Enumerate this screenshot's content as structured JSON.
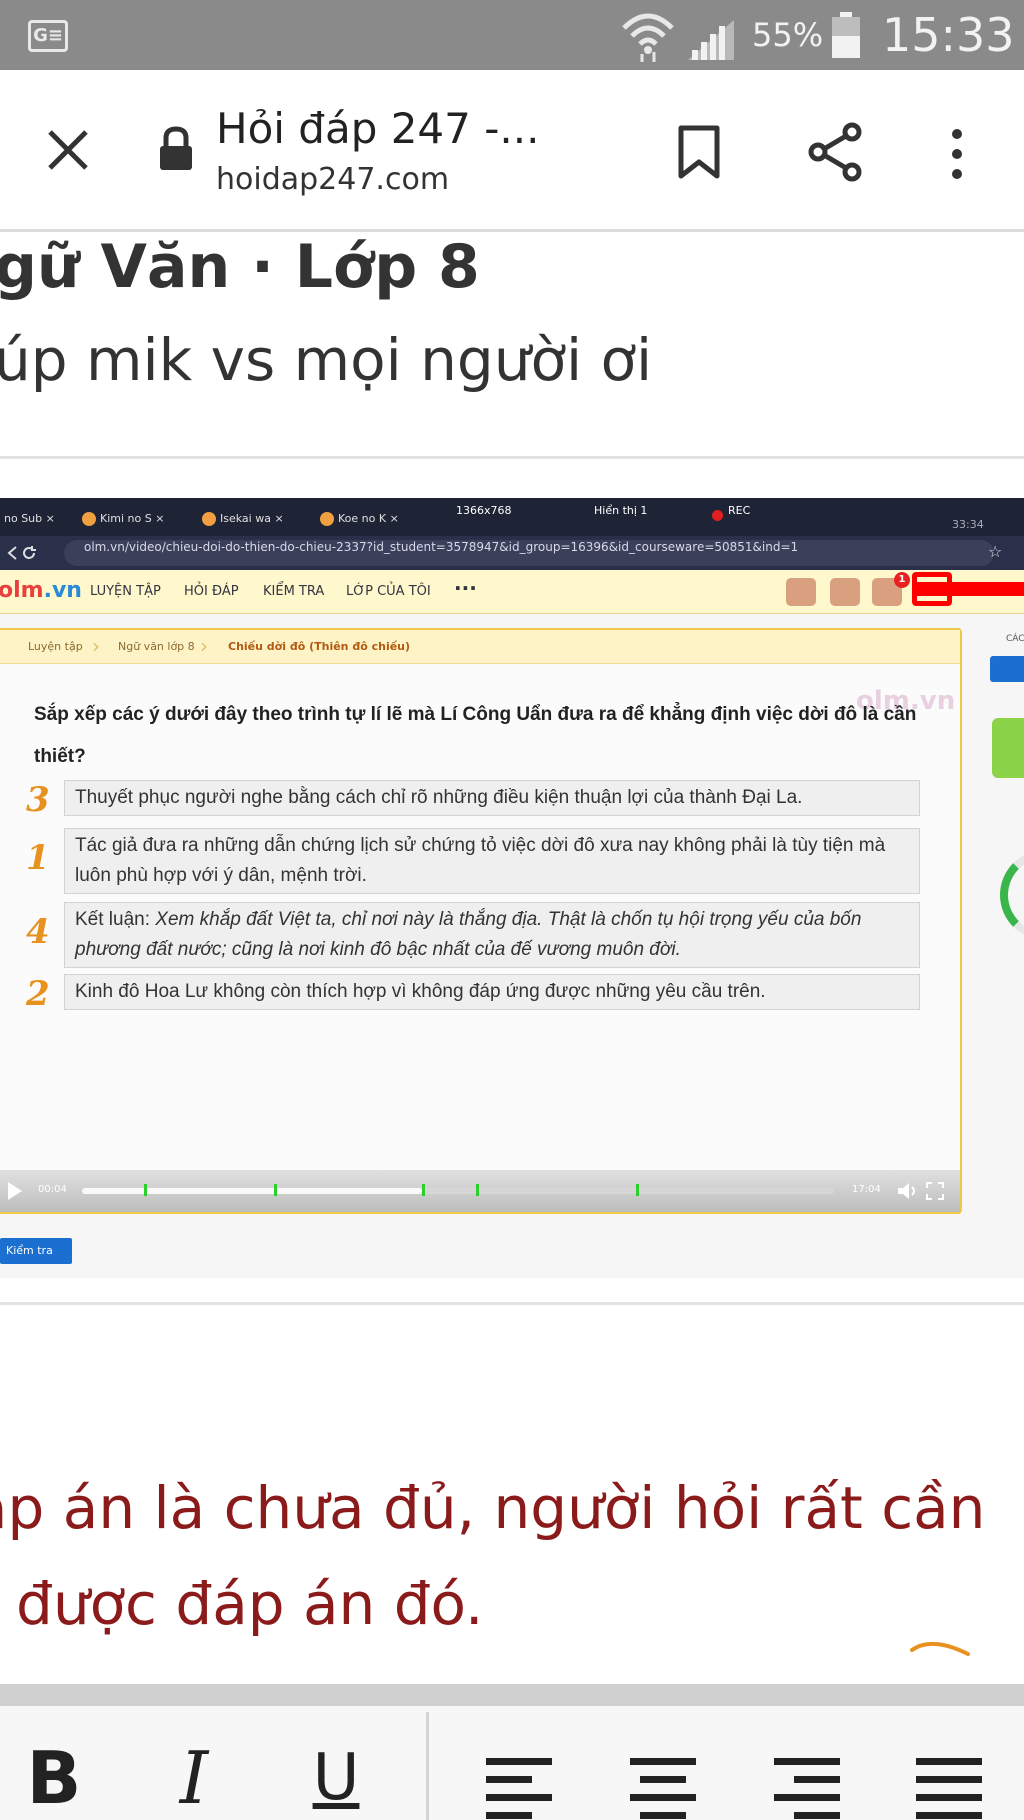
{
  "status_bar": {
    "carrier_icon_text": "G≡",
    "battery_percent": "55%",
    "time": "15:33"
  },
  "toolbar": {
    "title": "Hỏi đáp 247 -...",
    "url": "hoidap247.com"
  },
  "page": {
    "subject": "gữ Văn · Lớp 8",
    "question": "úp mik vs mọi người ơi",
    "warning_line1": "áp án là chưa đủ, người hỏi rất cần",
    "warning_line2": "được đáp án đó."
  },
  "screenshot": {
    "tabs": [
      {
        "label": "no Sub",
        "close": "×"
      },
      {
        "label": "Kimi no S",
        "close": "×"
      },
      {
        "label": "Isekai wa",
        "close": "×"
      },
      {
        "label": "Koe no K",
        "close": "×"
      }
    ],
    "resolution": "1366x768",
    "display": "Hiển thị 1",
    "rec": "REC",
    "clock": "33:34",
    "url": "olm.vn/video/chieu-doi-do-thien-do-chieu-2337?id_student=3578947&id_group=16396&id_courseware=50851&ind=1",
    "logo_main": "olm",
    "logo_ext": ".vn",
    "nav": [
      "LUYỆN TẬP",
      "HỎI ĐÁP",
      "KIỂM TRA",
      "LỚP CỦA TÔI"
    ],
    "nav_more": "···",
    "badge": "1",
    "breadcrumbs": [
      "Luyện tập",
      "Ngữ văn lớp 8",
      "Chiếu dời đô (Thiên đô chiếu)"
    ],
    "watermark": "olm.vn",
    "question": "Sắp xếp các ý dưới đây theo trình tự lí lẽ mà Lí Công Uẩn đưa ra để khẳng định việc dời đô là cần thiết?",
    "items": [
      {
        "mark": "3",
        "text": "Thuyết phục người nghe bằng cách chỉ rõ những điều kiện thuận lợi của thành Đại La."
      },
      {
        "mark": "1",
        "text": "Tác giả đưa ra những dẫn chứng lịch sử chứng tỏ việc dời đô xưa nay không phải là tùy tiện mà luôn phù hợp với ý dân, mệnh trời."
      },
      {
        "mark": "4",
        "prefix": "Kết luận: ",
        "text": "Xem khắp đất Việt ta, chỉ nơi này là thắng địa. Thật là chốn tụ hội trọng yếu của bốn phương đất nước; cũng là nơi kinh đô bậc nhất của đế vương muôn đời."
      },
      {
        "mark": "2",
        "text": "Kinh đô Hoa Lư không còn thích hợp vì không đáp ứng được những yêu cầu trên."
      }
    ],
    "time_current": "00:04",
    "time_total": "17:04",
    "check_button": "Kiểm tra",
    "side_label": "CÁC"
  },
  "editor": {
    "bold": "B",
    "italic": "I",
    "underline": "U"
  },
  "colors": {
    "status_bar": "#8a8a8a",
    "warning_text": "#8b1b1b",
    "olm_nav": "#fff8cc",
    "handwriting": "#e7921e"
  }
}
